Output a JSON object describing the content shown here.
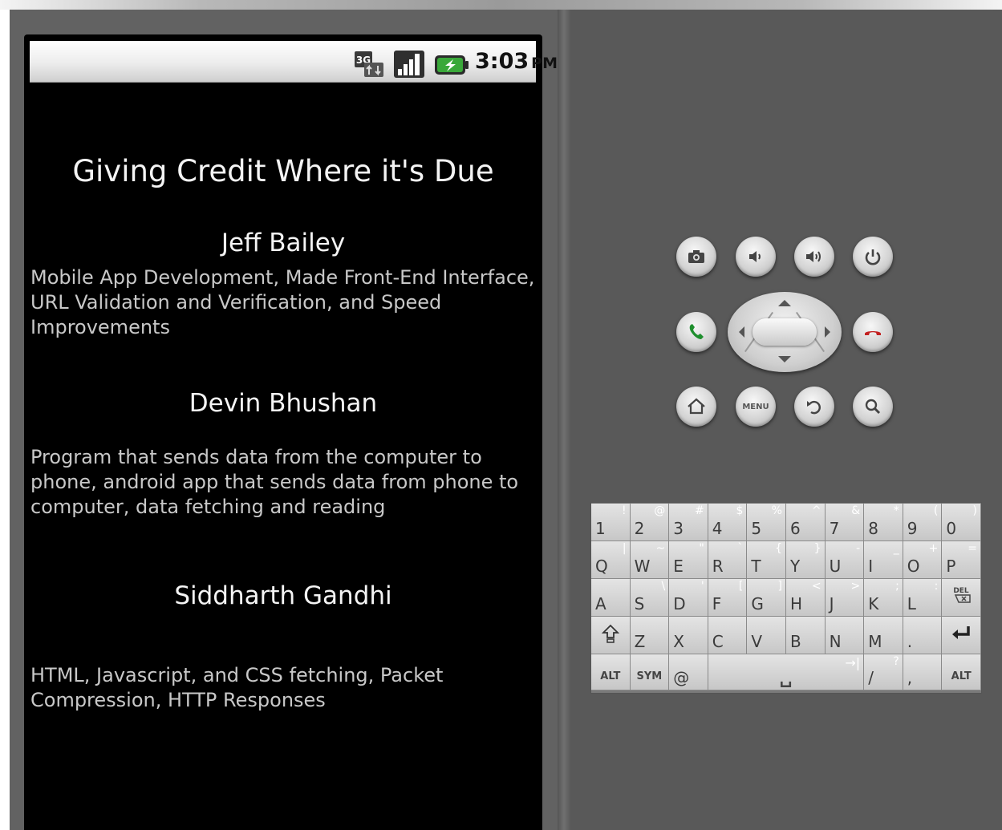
{
  "status_bar": {
    "network": "3G",
    "time": "3:03",
    "ampm": "PM"
  },
  "app": {
    "title": "Giving Credit Where it's Due",
    "credits": [
      {
        "name": "Jeff Bailey",
        "description": "Mobile App Development, Made Front-End Interface, URL Validation and Verification, and Speed Improvements"
      },
      {
        "name": "Devin Bhushan",
        "description": "Program that sends data from the computer to phone, android app that sends data from phone to computer, data fetching and reading"
      },
      {
        "name": "Siddharth Gandhi",
        "description": "HTML, Javascript, and CSS fetching, Packet Compression, HTTP Responses"
      }
    ]
  },
  "hardware_buttons": {
    "menu_label": "MENU",
    "icons": [
      "camera-icon",
      "volume-down-icon",
      "volume-up-icon",
      "power-icon",
      "call-icon",
      "dpad",
      "end-call-icon",
      "home-icon",
      "menu-icon",
      "back-icon",
      "search-icon"
    ]
  },
  "keyboard": {
    "rows": [
      [
        [
          "1",
          "!"
        ],
        [
          "2",
          "@"
        ],
        [
          "3",
          "#"
        ],
        [
          "4",
          "$"
        ],
        [
          "5",
          "%"
        ],
        [
          "6",
          "^"
        ],
        [
          "7",
          "&"
        ],
        [
          "8",
          "*"
        ],
        [
          "9",
          "("
        ],
        [
          "0",
          ")"
        ]
      ],
      [
        [
          "Q",
          "|"
        ],
        [
          "W",
          "~"
        ],
        [
          "E",
          "\""
        ],
        [
          "R",
          "`"
        ],
        [
          "T",
          "{"
        ],
        [
          "Y",
          "}"
        ],
        [
          "U",
          "-"
        ],
        [
          "I",
          "_"
        ],
        [
          "O",
          "+"
        ],
        [
          "P",
          "="
        ]
      ],
      [
        [
          "A",
          ""
        ],
        [
          "S",
          "\\"
        ],
        [
          "D",
          "'"
        ],
        [
          "F",
          "["
        ],
        [
          "G",
          "]"
        ],
        [
          "H",
          "<"
        ],
        [
          "J",
          ">"
        ],
        [
          "K",
          ";"
        ],
        [
          "L",
          ":"
        ],
        [
          "DEL",
          ""
        ]
      ],
      [
        [
          "SHIFT",
          ""
        ],
        [
          "Z",
          ""
        ],
        [
          "X",
          ""
        ],
        [
          "C",
          ""
        ],
        [
          "V",
          ""
        ],
        [
          "B",
          ""
        ],
        [
          "N",
          ""
        ],
        [
          "M",
          ""
        ],
        [
          ".",
          ""
        ],
        [
          "ENTER",
          ""
        ]
      ]
    ],
    "bottom_row": {
      "alt_left": "ALT",
      "sym": "SYM",
      "at": "@",
      "space": "␣",
      "tab": "→|",
      "slash": "/",
      "question": "?",
      "comma": ",",
      "alt_right": "ALT"
    }
  },
  "colors": {
    "call_green": "#1f8f2e",
    "end_red": "#c22020",
    "battery_green": "#3aa83a"
  }
}
